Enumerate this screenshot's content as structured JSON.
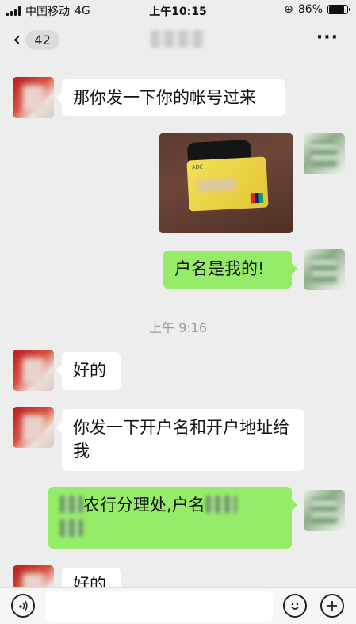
{
  "status_bar": {
    "carrier": "中国移动",
    "network": "4G",
    "time": "上午10:15",
    "battery": "86%"
  },
  "header": {
    "unread_count": "42"
  },
  "messages": [
    {
      "text": "那你发一下你的帐号过来"
    },
    {
      "text": "户名是我的!"
    },
    {
      "text": "好的"
    },
    {
      "text": "你发一下开户名和开户地址给我"
    },
    {
      "text_middle": "农行分理处,户名"
    },
    {
      "text": "好的"
    }
  ],
  "timestamp": "上午 9:16",
  "icons": {
    "back": "chevron-left-icon",
    "more": "more-icon",
    "voice": "voice-icon",
    "emoji": "emoji-icon",
    "add": "plus-icon"
  }
}
